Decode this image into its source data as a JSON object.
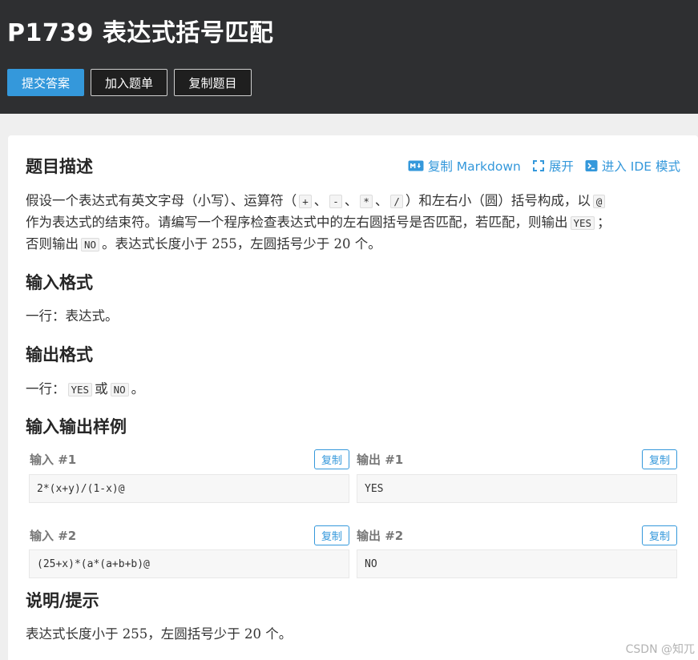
{
  "header": {
    "title": "P1739 表达式括号匹配",
    "buttons": {
      "submit": "提交答案",
      "add_list": "加入题单",
      "copy_problem": "复制题目"
    }
  },
  "toolbar": {
    "copy_markdown": "复制 Markdown",
    "expand": "展开",
    "ide_mode": "进入 IDE 模式"
  },
  "sections": {
    "description": {
      "title": "题目描述",
      "line1": {
        "a": "假设一个表达式有英文字母（小写）、运算符（",
        "op1": "+",
        "sep1": "、",
        "op2": "-",
        "sep2": "、",
        "op3": "*",
        "sep3": "、",
        "op4": "/",
        "b": "）和左右小（圆）括号构成，以",
        "end": "@"
      },
      "line2": {
        "a": "作为表达式的结束符。请编写一个程序检查表达式中的左右圆括号是否匹配，若匹配，则输出",
        "yes": "YES",
        "b": "；"
      },
      "line3": {
        "a": "否则输出",
        "no": "NO",
        "b": "。表达式长度小于 255，左圆括号少于 20 个。"
      }
    },
    "input_format": {
      "title": "输入格式",
      "text": "一行：表达式。"
    },
    "output_format": {
      "title": "输出格式",
      "a": "一行：",
      "yes": "YES",
      "or": "或",
      "no": "NO",
      "b": "。"
    },
    "samples": {
      "title": "输入输出样例",
      "copy_label": "复制",
      "items": [
        {
          "in_label": "输入 #1",
          "out_label": "输出 #1",
          "input": "2*(x+y)/(1-x)@",
          "output": "YES"
        },
        {
          "in_label": "输入 #2",
          "out_label": "输出 #2",
          "input": "(25+x)*(a*(a+b+b)@",
          "output": "NO"
        }
      ]
    },
    "hint": {
      "title": "说明/提示",
      "text": "表达式长度小于 255，左圆括号少于 20 个。"
    }
  },
  "watermark": "CSDN @知兀",
  "colors": {
    "header_bg": "#2e2f31",
    "accent": "#3498db",
    "page_bg": "#efefef"
  },
  "icons": {
    "markdown": "markdown-icon",
    "expand": "expand-icon",
    "ide": "terminal-icon"
  }
}
